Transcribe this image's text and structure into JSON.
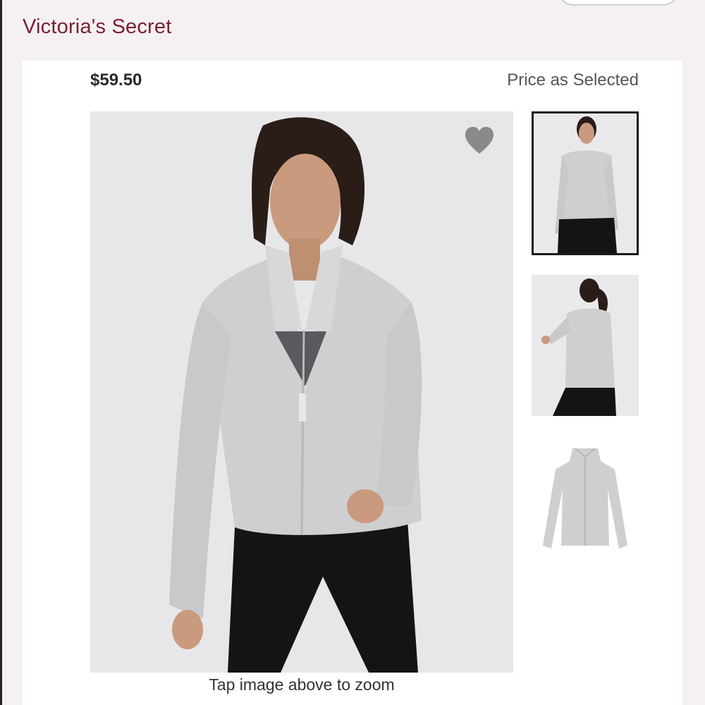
{
  "header": {
    "brand": "Victoria's Secret"
  },
  "product": {
    "price": "$59.50",
    "price_note": "Price as Selected",
    "zoom_hint": "Tap image above to zoom"
  },
  "icons": {
    "favorite": "heart-icon"
  },
  "colors": {
    "brand": "#7a1f33",
    "heart": "#8a8a8a",
    "jacket": "#cfcfd1",
    "leggings": "#141414"
  },
  "thumbnails": [
    {
      "view": "front",
      "selected": true
    },
    {
      "view": "back",
      "selected": false
    },
    {
      "view": "flat-lay",
      "selected": false
    }
  ]
}
